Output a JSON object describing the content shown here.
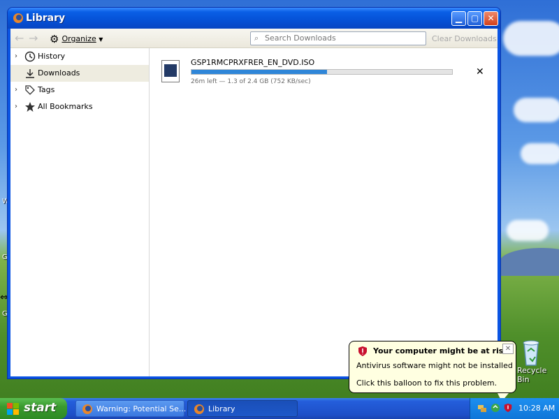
{
  "window": {
    "title": "Library"
  },
  "toolbar": {
    "back_icon": "arrow-left-icon",
    "forward_icon": "arrow-right-icon",
    "organize_label": "Organize",
    "search_placeholder": "Search Downloads",
    "clear_downloads_label": "Clear Downloads"
  },
  "sidebar": {
    "items": [
      {
        "label": "History",
        "icon": "clock-icon",
        "expandable": true
      },
      {
        "label": "Downloads",
        "icon": "download-icon",
        "expandable": false,
        "selected": true
      },
      {
        "label": "Tags",
        "icon": "tag-icon",
        "expandable": true
      },
      {
        "label": "All Bookmarks",
        "icon": "star-icon",
        "expandable": true
      }
    ]
  },
  "downloads": [
    {
      "filename": "GSP1RMCPRXFRER_EN_DVD.ISO",
      "status": "26m left — 1.3 of 2.4 GB (752 KB/sec)",
      "progress_fraction": 0.52,
      "cancel_glyph": "✕"
    }
  ],
  "balloon": {
    "title": "Your computer might be at risk",
    "line1": "Antivirus software might not be installed",
    "line2": "Click this balloon to fix this problem.",
    "close_glyph": "✕"
  },
  "desktop": {
    "recycle_label": "Recycle Bin",
    "edge_glyphs": [
      "W",
      "G",
      "G"
    ]
  },
  "taskbar": {
    "start_label": "start",
    "tasks": [
      {
        "label": "Warning: Potential Se...",
        "active": false
      },
      {
        "label": "Library",
        "active": true
      }
    ],
    "clock": "10:28 AM"
  },
  "colors": {
    "titlebar": "#0a54e3",
    "progress_fill": "#2f86d8",
    "balloon_bg": "#ffffe1",
    "start_green": "#3a9a2f",
    "taskbar_blue": "#245edb"
  }
}
